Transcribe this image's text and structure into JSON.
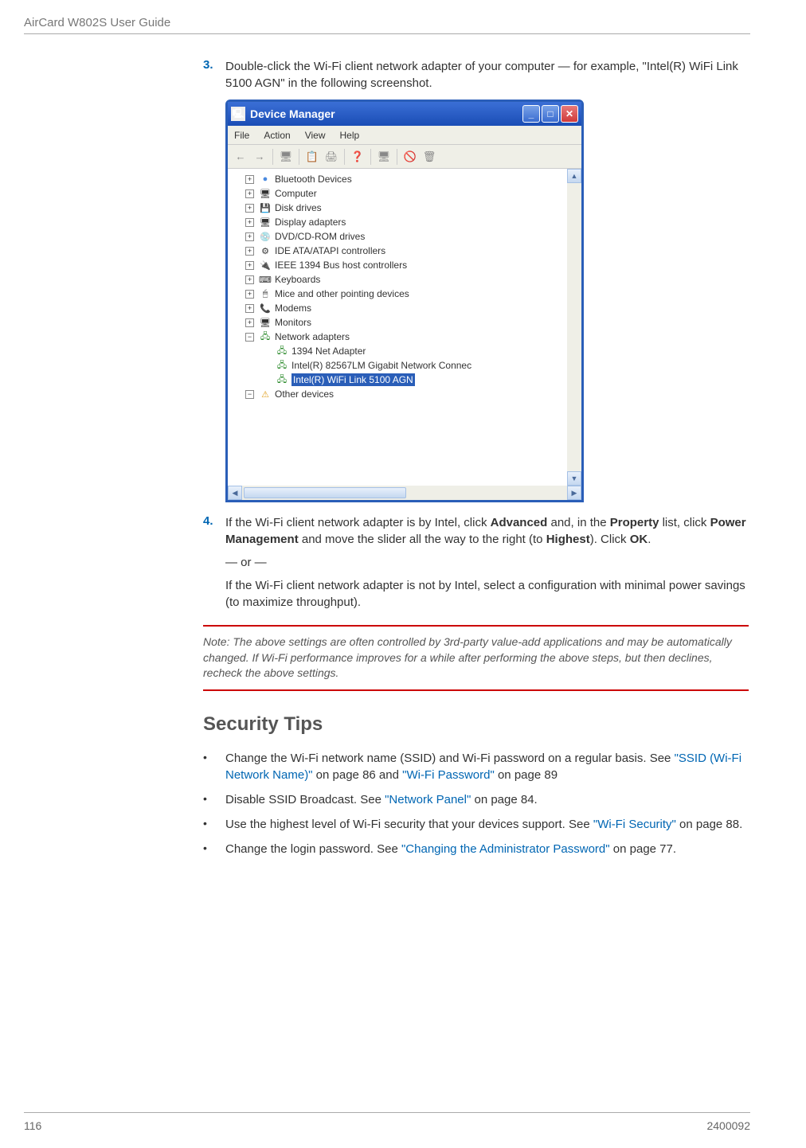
{
  "header": {
    "title": "AirCard W802S User Guide"
  },
  "steps": {
    "s3": {
      "num": "3.",
      "text_before": "Double-click the Wi-Fi client network adapter of your computer — for example, \"Intel(R) WiFi Link 5100 AGN\" in the following screenshot."
    },
    "s4": {
      "num": "4.",
      "text_a": "If the Wi-Fi client network adapter is by Intel, click ",
      "bold_a": "Advanced",
      "text_b": " and, in the ",
      "bold_b": "Property",
      "text_c": " list, click ",
      "bold_c": "Power Management",
      "text_d": " and move the slider all the way to the right (to ",
      "bold_d": "Highest",
      "text_e": "). Click ",
      "bold_e": "OK",
      "text_f": ".",
      "or": "— or —",
      "alt": "If the Wi-Fi client network adapter is not by Intel, select a configuration with minimal power savings (to maximize throughput)."
    }
  },
  "window": {
    "title": "Device Manager",
    "menu": {
      "file": "File",
      "action": "Action",
      "view": "View",
      "help": "Help"
    },
    "tree": {
      "bluetooth": "Bluetooth Devices",
      "computer": "Computer",
      "disk": "Disk drives",
      "display": "Display adapters",
      "dvd": "DVD/CD-ROM drives",
      "ide": "IDE ATA/ATAPI controllers",
      "ieee": "IEEE 1394 Bus host controllers",
      "keyboards": "Keyboards",
      "mice": "Mice and other pointing devices",
      "modems": "Modems",
      "monitors": "Monitors",
      "network": "Network adapters",
      "net1": "1394 Net Adapter",
      "net2": "Intel(R) 82567LM Gigabit Network Connec",
      "net3": "Intel(R) WiFi Link 5100 AGN",
      "other": "Other devices"
    }
  },
  "note": {
    "text": "Note: The above settings are often controlled by 3rd-party value-add applications and may be automatically changed. If Wi-Fi performance improves for a while after performing the above steps, but then declines, recheck the above settings."
  },
  "security": {
    "heading": "Security Tips",
    "b1": {
      "a": "Change the Wi-Fi network name (SSID) and Wi-Fi password on a regular basis. See ",
      "link1": "\"SSID (Wi-Fi Network Name)\"",
      "b": " on page 86 and ",
      "link2": "\"Wi-Fi Password\"",
      "c": " on page 89"
    },
    "b2": {
      "a": "Disable SSID Broadcast. See ",
      "link": "\"Network Panel\"",
      "b": " on page 84."
    },
    "b3": {
      "a": "Use the highest level of Wi-Fi security that your devices support. See ",
      "link": "\"Wi-Fi Security\"",
      "b": " on page 88."
    },
    "b4": {
      "a": "Change the login password. See ",
      "link": "\"Changing the Administrator Password\"",
      "b": " on page 77."
    }
  },
  "footer": {
    "page": "116",
    "docnum": "2400092"
  }
}
